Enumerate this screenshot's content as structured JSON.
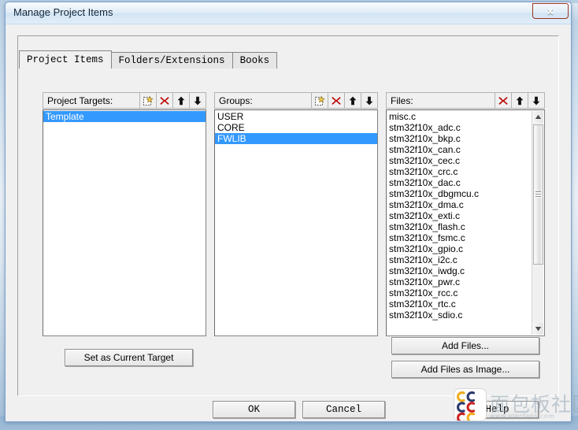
{
  "window": {
    "title": "Manage Project Items",
    "close_label": "x"
  },
  "tabs": [
    {
      "label": "Project Items",
      "active": true
    },
    {
      "label": "Folders/Extensions",
      "active": false
    },
    {
      "label": "Books",
      "active": false
    }
  ],
  "columns": {
    "targets": {
      "label": "Project Targets:",
      "icons": [
        "new-item-icon",
        "delete-icon",
        "move-up-icon",
        "move-down-icon"
      ],
      "items": [
        {
          "label": "Template",
          "selected": true
        }
      ]
    },
    "groups": {
      "label": "Groups:",
      "icons": [
        "new-item-icon",
        "delete-icon",
        "move-up-icon",
        "move-down-icon"
      ],
      "items": [
        {
          "label": "USER",
          "selected": false
        },
        {
          "label": "CORE",
          "selected": false
        },
        {
          "label": "FWLIB",
          "selected": true
        }
      ]
    },
    "files": {
      "label": "Files:",
      "icons": [
        "delete-icon",
        "move-up-icon",
        "move-down-icon"
      ],
      "items": [
        {
          "label": "misc.c",
          "selected": false
        },
        {
          "label": "stm32f10x_adc.c",
          "selected": false
        },
        {
          "label": "stm32f10x_bkp.c",
          "selected": false
        },
        {
          "label": "stm32f10x_can.c",
          "selected": false
        },
        {
          "label": "stm32f10x_cec.c",
          "selected": false
        },
        {
          "label": "stm32f10x_crc.c",
          "selected": false
        },
        {
          "label": "stm32f10x_dac.c",
          "selected": false
        },
        {
          "label": "stm32f10x_dbgmcu.c",
          "selected": false
        },
        {
          "label": "stm32f10x_dma.c",
          "selected": false
        },
        {
          "label": "stm32f10x_exti.c",
          "selected": false
        },
        {
          "label": "stm32f10x_flash.c",
          "selected": false
        },
        {
          "label": "stm32f10x_fsmc.c",
          "selected": false
        },
        {
          "label": "stm32f10x_gpio.c",
          "selected": false
        },
        {
          "label": "stm32f10x_i2c.c",
          "selected": false
        },
        {
          "label": "stm32f10x_iwdg.c",
          "selected": false
        },
        {
          "label": "stm32f10x_pwr.c",
          "selected": false
        },
        {
          "label": "stm32f10x_rcc.c",
          "selected": false
        },
        {
          "label": "stm32f10x_rtc.c",
          "selected": false
        },
        {
          "label": "stm32f10x_sdio.c",
          "selected": false
        }
      ]
    }
  },
  "buttons": {
    "set_current_target": "Set as Current Target",
    "add_files": "Add Files...",
    "add_files_as_image": "Add Files as Image...",
    "ok": "OK",
    "cancel": "Cancel",
    "help": "Help"
  },
  "watermark": {
    "text": "面包板社区",
    "subtext": "www.elecfans.com"
  },
  "colors": {
    "selection": "#3399ff",
    "delete_icon": "#c00000",
    "close_button": "#c0392b",
    "dialog_face": "#f0f0f0"
  }
}
